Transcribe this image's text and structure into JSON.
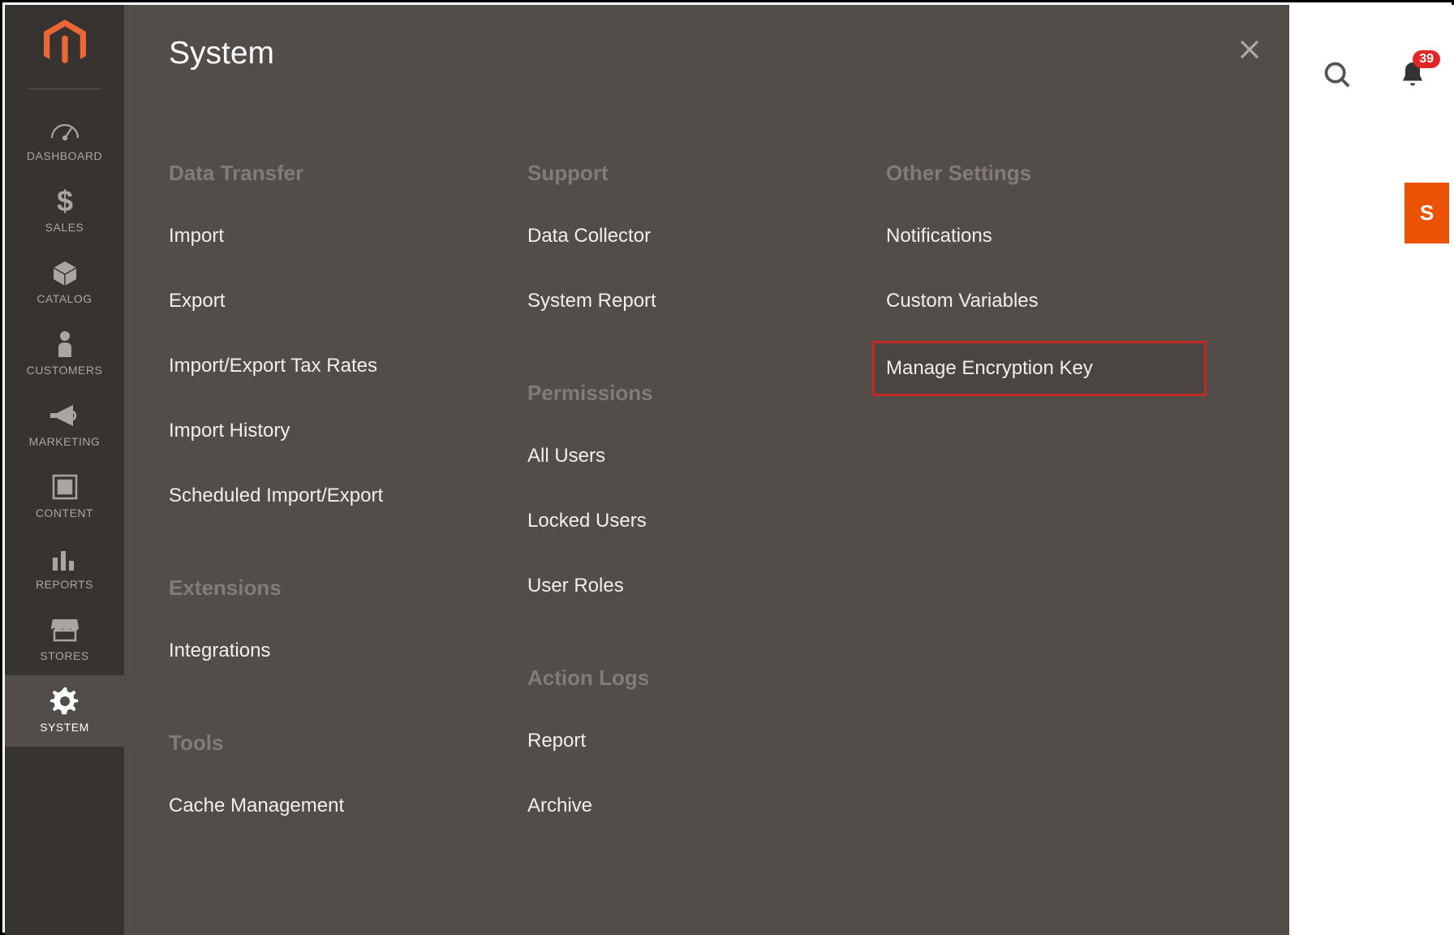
{
  "sidebar": {
    "items": [
      {
        "id": "dashboard",
        "label": "DASHBOARD"
      },
      {
        "id": "sales",
        "label": "SALES"
      },
      {
        "id": "catalog",
        "label": "CATALOG"
      },
      {
        "id": "customers",
        "label": "CUSTOMERS"
      },
      {
        "id": "marketing",
        "label": "MARKETING"
      },
      {
        "id": "content",
        "label": "CONTENT"
      },
      {
        "id": "reports",
        "label": "REPORTS"
      },
      {
        "id": "stores",
        "label": "STORES"
      },
      {
        "id": "system",
        "label": "SYSTEM"
      }
    ],
    "active": "system"
  },
  "flyout": {
    "title": "System",
    "columns": [
      {
        "groups": [
          {
            "heading": "Data Transfer",
            "items": [
              "Import",
              "Export",
              "Import/Export Tax Rates",
              "Import History",
              "Scheduled Import/Export"
            ]
          },
          {
            "heading": "Extensions",
            "items": [
              "Integrations"
            ]
          },
          {
            "heading": "Tools",
            "items": [
              "Cache Management"
            ]
          }
        ]
      },
      {
        "groups": [
          {
            "heading": "Support",
            "items": [
              "Data Collector",
              "System Report"
            ]
          },
          {
            "heading": "Permissions",
            "items": [
              "All Users",
              "Locked Users",
              "User Roles"
            ]
          },
          {
            "heading": "Action Logs",
            "items": [
              "Report",
              "Archive"
            ]
          }
        ]
      },
      {
        "groups": [
          {
            "heading": "Other Settings",
            "items": [
              "Notifications",
              "Custom Variables",
              "Manage Encryption Key"
            ],
            "highlighted_index": 2
          }
        ]
      }
    ]
  },
  "topbar": {
    "notification_count": "39",
    "button_fragment": "S"
  }
}
